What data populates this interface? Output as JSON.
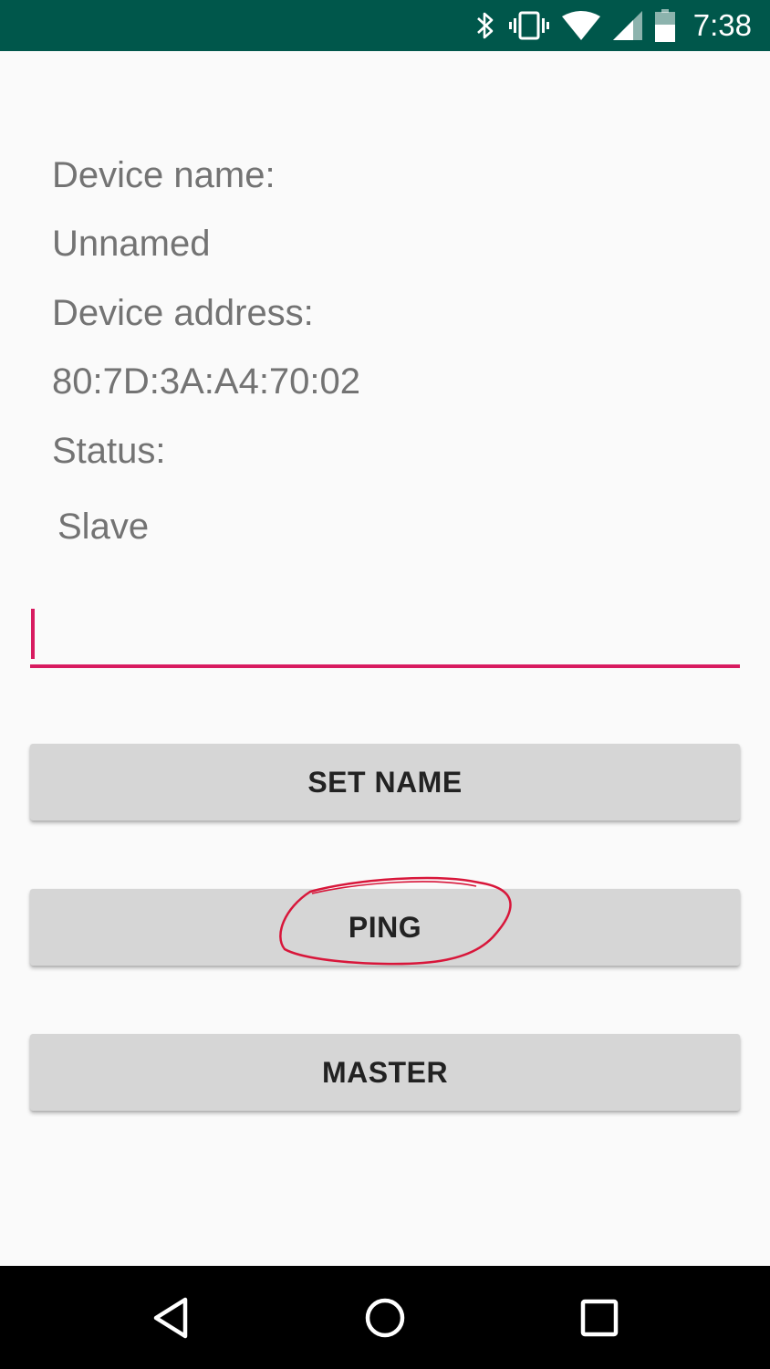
{
  "status_bar": {
    "time": "7:38",
    "icons": [
      "bluetooth-icon",
      "vibrate-icon",
      "wifi-icon",
      "cell-signal-icon",
      "battery-icon"
    ],
    "background": "#00574b"
  },
  "device_info": {
    "name_label": "Device name:",
    "name_value": "Unnamed",
    "address_label": "Device address:",
    "address_value": "80:7D:3A:A4:70:02",
    "status_label": "Status:",
    "status_value": "Slave"
  },
  "name_input": {
    "value": "",
    "placeholder": "",
    "accent": "#d81b60"
  },
  "buttons": {
    "set_name": "SET NAME",
    "ping": "PING",
    "master": "MASTER"
  },
  "annotation_color": "#d8163a",
  "nav_bar": {
    "icons": [
      "back-icon",
      "home-icon",
      "recents-icon"
    ]
  }
}
